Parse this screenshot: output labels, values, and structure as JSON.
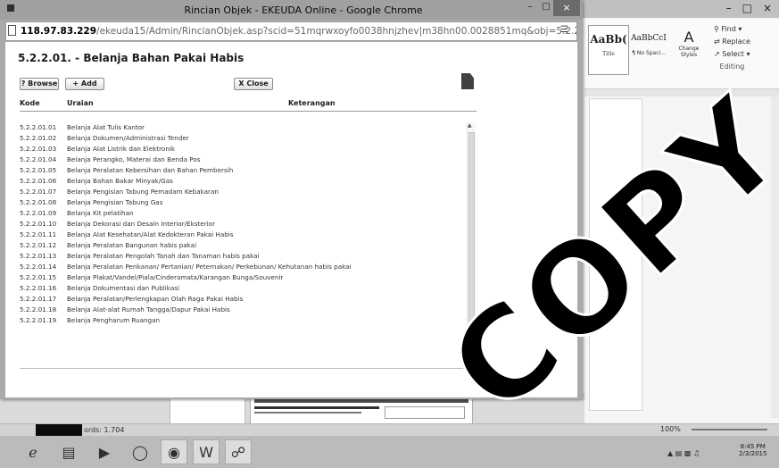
{
  "window": {
    "title": "Rincian Objek - EKEUDA Online - Google Chrome",
    "address_host": "118.97.83.229",
    "address_path": "/ekeuda15/Admin/RincianObjek.asp?scid=51mqrwxoyfo0038hnjzhev|m38hn00.0028851mq&obj=5.2.2.01."
  },
  "page": {
    "title": "5.2.2.01. - Belanja Bahan Pakai Habis",
    "browse_label": "? Browse",
    "add_label": "+ Add",
    "close_label": "X Close",
    "col_kode": "Kode",
    "col_uraian": "Uraian",
    "col_keterangan": "Keterangan"
  },
  "items": [
    {
      "kode": "5.2.2.01.01",
      "uraian": "Belanja Alat Tulis Kantor"
    },
    {
      "kode": "5.2.2.01.02",
      "uraian": "Belanja Dokumen/Administrasi Tender"
    },
    {
      "kode": "5.2.2.01.03",
      "uraian": "Belanja Alat Listrik dan Elektronik"
    },
    {
      "kode": "5.2.2.01.04",
      "uraian": "Belanja Perangko, Materai dan Benda Pos"
    },
    {
      "kode": "5.2.2.01.05",
      "uraian": "Belanja Peralatan Kebersihan dan Bahan Pembersih"
    },
    {
      "kode": "5.2.2.01.06",
      "uraian": "Belanja Bahan Bakar Minyak/Gas"
    },
    {
      "kode": "5.2.2.01.07",
      "uraian": "Belanja Pengisian Tabung Pemadam Kebakaran"
    },
    {
      "kode": "5.2.2.01.08",
      "uraian": "Belanja Pengisian Tabung Gas"
    },
    {
      "kode": "5.2.2.01.09",
      "uraian": "Belanja Kit pelatihan"
    },
    {
      "kode": "5.2.2.01.10",
      "uraian": "Belanja Dekorasi dan Desain Interior/Eksterior"
    },
    {
      "kode": "5.2.2.01.11",
      "uraian": "Belanja Alat Kesehatan/Alat Kedokteran Pakai Habis"
    },
    {
      "kode": "5.2.2.01.12",
      "uraian": "Belanja Peralatan Bangunan habis pakai"
    },
    {
      "kode": "5.2.2.01.13",
      "uraian": "Belanja Peralatan Pengolah Tanah dan Tanaman habis pakai"
    },
    {
      "kode": "5.2.2.01.14",
      "uraian": "Belanja Peralatan Perikanan/ Pertanian/ Peternakan/ Perkebunan/ Kehutanan habis pakai"
    },
    {
      "kode": "5.2.2.01.15",
      "uraian": "Belanja Plakat/Vandel/Piala/Cinderamata/Karangan Bunga/Souvenir"
    },
    {
      "kode": "5.2.2.01.16",
      "uraian": "Belanja Dokumentasi dan Publikasi"
    },
    {
      "kode": "5.2.2.01.17",
      "uraian": "Belanja Peralatan/Perlengkapan Olah Raga Pakai Habis"
    },
    {
      "kode": "5.2.2.01.18",
      "uraian": "Belanja Alat-alat Rumah Tangga/Dapur Pakai Habis"
    },
    {
      "kode": "5.2.2.01.19",
      "uraian": "Belanja Pengharum Ruangan"
    }
  ],
  "word": {
    "style1": "AaBb(",
    "style1_label": "Title",
    "style2": "AaBbCcI",
    "style2_label": "¶ No Spaci...",
    "change_styles": "Change Styles",
    "find": "Find",
    "replace": "Replace",
    "select": "Select",
    "editing": "Editing",
    "status_words": "ords: 1.704",
    "zoom": "100%"
  },
  "clock": {
    "time": "8:45 PM",
    "date": "2/3/2015"
  },
  "watermark": "COPY"
}
